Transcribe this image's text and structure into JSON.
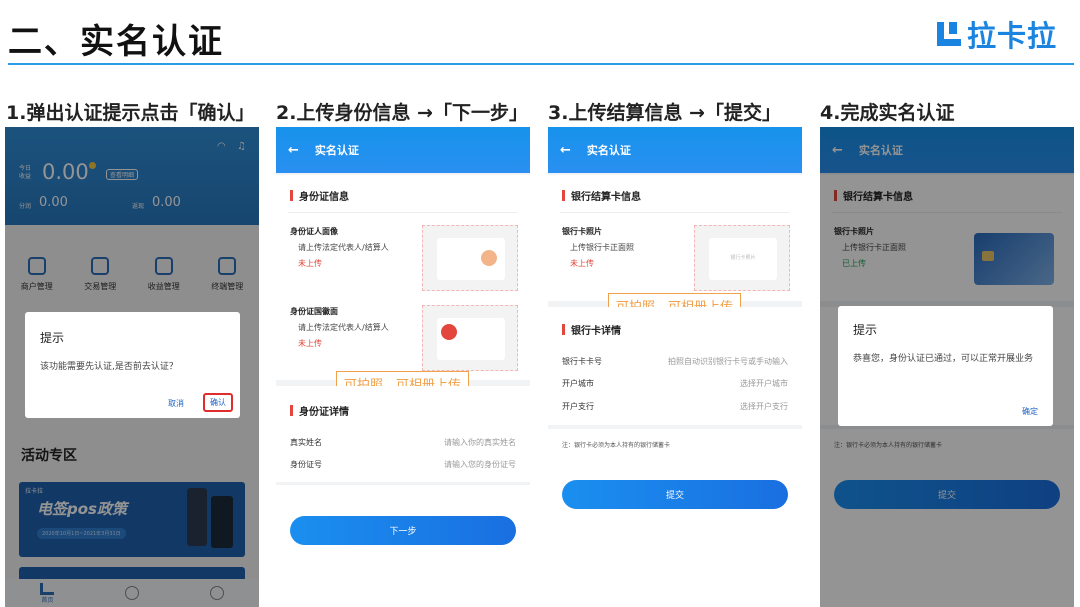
{
  "header": {
    "title": "二、实名认证",
    "brand": "拉卡拉"
  },
  "steps": [
    "1.弹出认证提示点击「确认」",
    "2.上传身份信息 →「下一步」",
    "3.上传结算信息 →「提交」",
    "4.完成实名认证"
  ],
  "p1": {
    "today_label": "今日\n收益",
    "amount": "0.00",
    "detail_badge": "查看明细",
    "row2_left_label": "分润",
    "row2_left": "0.00",
    "row2_right_label": "返现",
    "row2_right": "0.00",
    "menu": [
      "商户管理",
      "交易管理",
      "收益管理",
      "终端管理"
    ],
    "dialog": {
      "title": "提示",
      "message": "该功能需要先认证,是否前去认证？",
      "cancel": "取消",
      "confirm": "确认"
    },
    "activity": "活动专区",
    "banner_brand": "拉卡拉",
    "banner_title": "电签pos政策",
    "banner_date": "2020年10月1日~2021年3月31日",
    "tab_home": "首页"
  },
  "p2": {
    "nav_title": "实名认证",
    "section1": "身份证信息",
    "item1_title": "身份证人面像",
    "item1_desc": "请上传法定代表人/结算人",
    "item1_status": "未上传",
    "item2_title": "身份证国徽面",
    "item2_desc": "请上传法定代表人/结算人",
    "item2_status": "未上传",
    "callout": "可拍照，可相册上传",
    "section2": "身份证详情",
    "rows": [
      {
        "label": "真实姓名",
        "placeholder": "请输入你的真实姓名"
      },
      {
        "label": "身份证号",
        "placeholder": "请输入您的身份证号"
      }
    ],
    "next": "下一步"
  },
  "p3": {
    "nav_title": "实名认证",
    "section1": "银行结算卡信息",
    "item_title": "银行卡照片",
    "item_desc": "上传银行卡正面照",
    "item_status": "未上传",
    "card_text": "银行卡照片",
    "callout": "可拍照，可相册上传",
    "section2": "银行卡详情",
    "rows": [
      {
        "label": "银行卡卡号",
        "placeholder": "拍照自动识别银行卡号或手动输入"
      },
      {
        "label": "开户城市",
        "placeholder": "选择开户城市"
      },
      {
        "label": "开户支行",
        "placeholder": "选择开户支行"
      }
    ],
    "note": "注：银行卡必须为本人持有的银行储蓄卡",
    "submit": "提交"
  },
  "p4": {
    "nav_title": "实名认证",
    "section1": "银行结算卡信息",
    "item_title": "银行卡照片",
    "item_desc": "上传银行卡正面照",
    "item_status": "已上传",
    "note": "注：银行卡必须为本人持有的银行储蓄卡",
    "submit": "提交",
    "dialog": {
      "title": "提示",
      "message": "恭喜您，身份认证已通过，可以正常开展业务",
      "confirm": "确定"
    }
  }
}
